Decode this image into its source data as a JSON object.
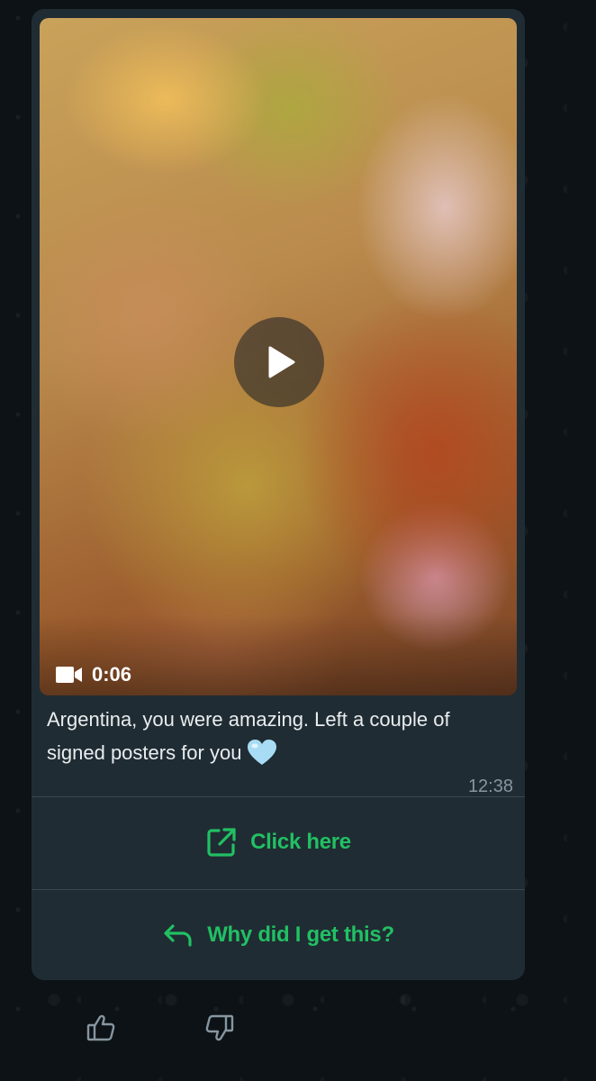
{
  "message": {
    "video": {
      "duration": "0:06",
      "icons": {
        "play": "play-icon",
        "camera": "video-camera-icon"
      }
    },
    "caption": "Argentina, you were amazing. Left a couple of signed posters for you",
    "emoji": "light-blue-heart",
    "time": "12:38"
  },
  "actions": {
    "click_here": {
      "label": "Click here",
      "icon": "external-link-icon"
    },
    "why": {
      "label": "Why did I get this?",
      "icon": "reply-icon"
    }
  },
  "reactions": [
    {
      "icon": "thumbs-up-icon"
    },
    {
      "icon": "thumbs-down-icon"
    }
  ],
  "colors": {
    "bubble": "#202c33",
    "accent": "#21c063",
    "text": "#e9edef",
    "meta": "#8696a0"
  }
}
